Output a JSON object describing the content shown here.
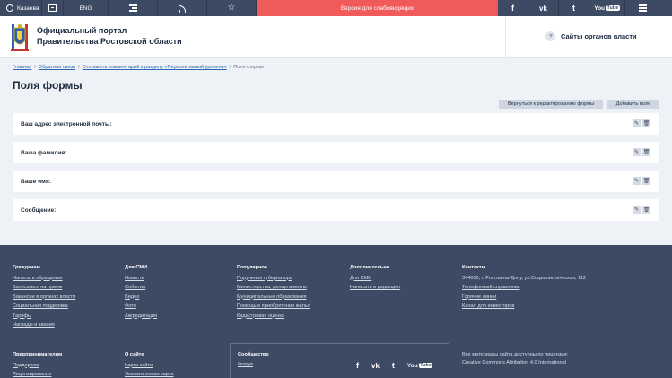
{
  "topbar": {
    "city": "Казаева",
    "lang": "ENG",
    "poor_vision": "Версия для слабовидящих",
    "social": {
      "facebook": "f",
      "vk": "vk",
      "twitter": "t",
      "youtube_left": "You",
      "youtube_right": "Tube"
    }
  },
  "header": {
    "portal_title_line1": "Официальный портал",
    "portal_title_line2": "Правительства Ростовской области",
    "sites_link": "Сайты органов власти"
  },
  "breadcrumb": {
    "items": [
      "Главная",
      "Обратная связь",
      "Отправить комментарий к разделу «Перспективный уровень»"
    ],
    "separator": "/",
    "current": "Поля формы"
  },
  "page": {
    "title": "Поля формы",
    "back_button": "Вернуться к редактированию формы",
    "add_button": "Добавить поле"
  },
  "fields": [
    {
      "label": "Ваш адрес электронной почты:"
    },
    {
      "label": "Ваша фамилия:"
    },
    {
      "label": "Ваше имя:"
    },
    {
      "label": "Сообщение:"
    }
  ],
  "footer": {
    "citizens": {
      "head": "Гражданам",
      "links": [
        "Написать обращение",
        "Записаться на прием",
        "Вакансии в органах власти",
        "Социальная поддержка",
        "Тарифы",
        "Награды и звания"
      ]
    },
    "media": {
      "head": "Для СМИ",
      "links": [
        "Новости",
        "События",
        "Видео",
        "Фото",
        "Аккредитация"
      ]
    },
    "popular": {
      "head": "Популярное",
      "links": [
        "Поручения губернатора",
        "Министерства, департаменты",
        "Муниципальные образования",
        "Помощь в приобретении жилья",
        "Кадастровая оценка"
      ]
    },
    "extra": {
      "head": "Дополнительно",
      "links": [
        "Для СМИ",
        "Написать в редакцию"
      ]
    },
    "contacts": {
      "head": "Контакты",
      "address": "344050, г. Ростов-на-Дону, ул.Социалистическая, 112",
      "links": [
        "Телефонный справочник",
        "Горячие линии",
        "Канал для инвесторов"
      ]
    },
    "business": {
      "head": "Предпринимателям",
      "links": [
        "Поддержка",
        "Лицензирование"
      ]
    },
    "about": {
      "head": "О сайте",
      "links": [
        "Карта сайта",
        "Экологическая карта"
      ]
    },
    "community": {
      "head": "Сообщество",
      "link": "Форум"
    },
    "license": {
      "text": "Все материалы сайта доступны по лицензии:",
      "link": "Creative Commons Attribution 4.0 International"
    }
  },
  "colors": {
    "topbar": "#3d4a63",
    "poor_vision": "#f05a5b",
    "footer": "#3d4a63",
    "link": "#2b66b1"
  }
}
